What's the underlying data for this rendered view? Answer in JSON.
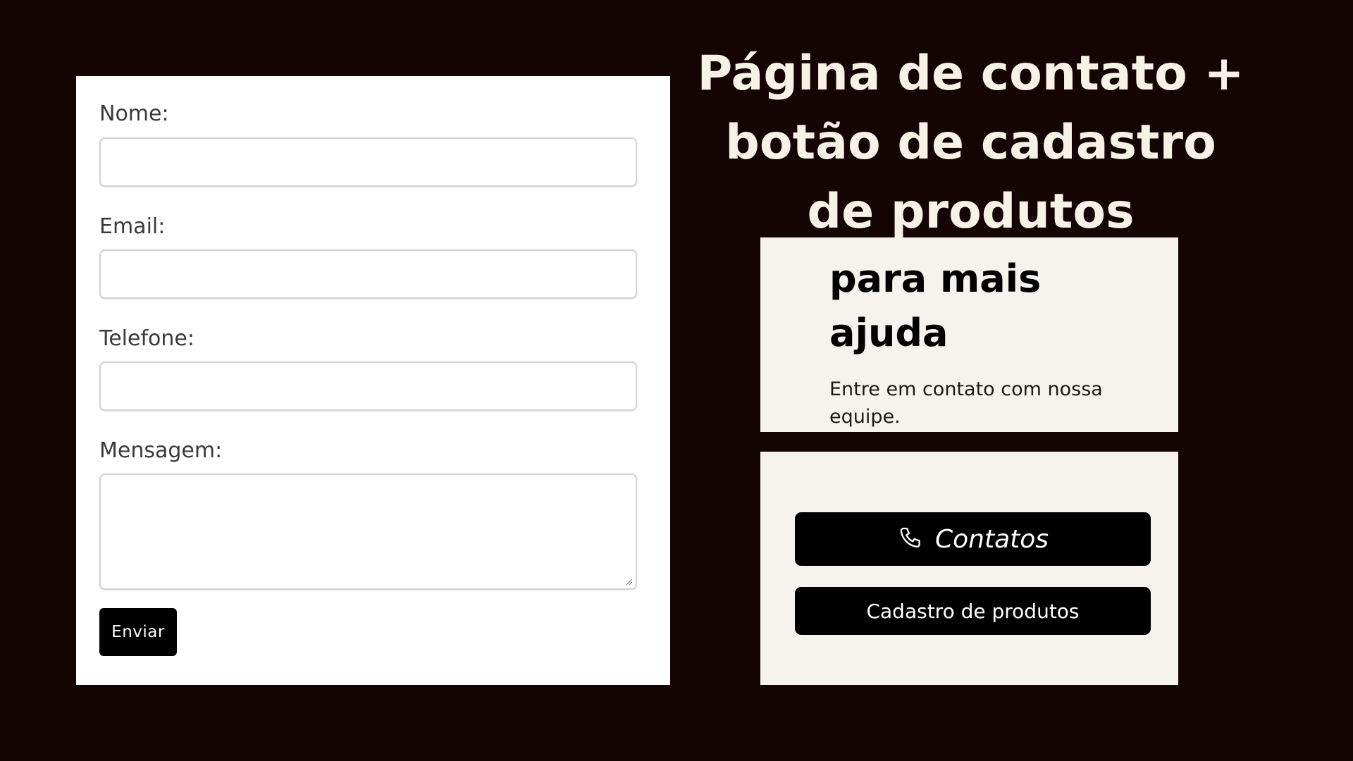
{
  "form": {
    "fields": [
      {
        "label": "Nome:",
        "value": ""
      },
      {
        "label": "Email:",
        "value": ""
      },
      {
        "label": "Telefone:",
        "value": ""
      },
      {
        "label": "Mensagem:",
        "value": ""
      }
    ],
    "submit_label": "Enviar"
  },
  "headline": {
    "title": "Página de contato + botão de cadastro de produtos"
  },
  "help": {
    "heading": "para mais ajuda",
    "text": "Entre em contato com nossa equipe."
  },
  "actions": {
    "contact_label": "Contatos",
    "contact_icon": "phone-icon",
    "product_label": "Cadastro de produtos"
  },
  "colors": {
    "background": "#140404",
    "title_text": "#f7f1e6",
    "card_bg": "#f6f3ee",
    "button_bg": "#000000"
  }
}
